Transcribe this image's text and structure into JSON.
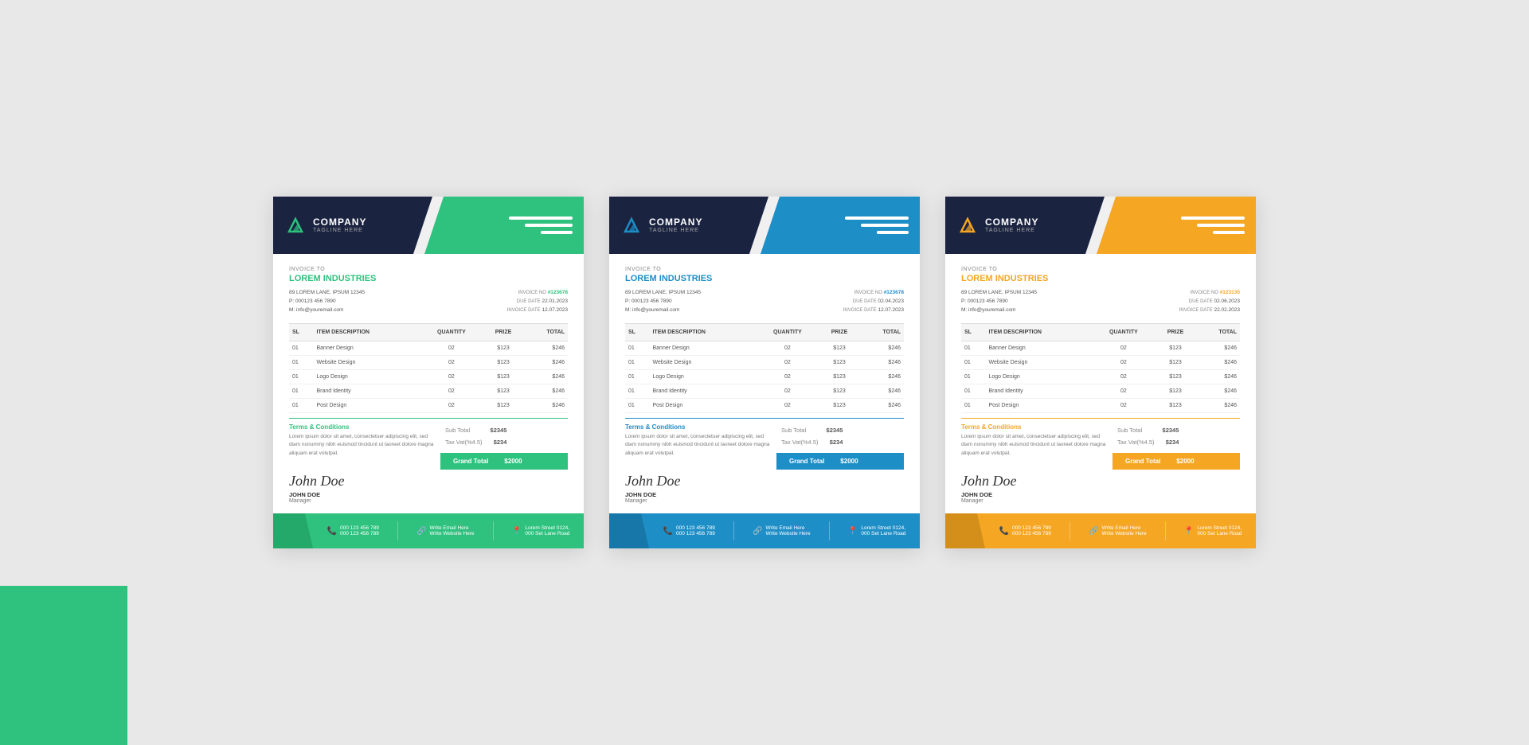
{
  "invoices": [
    {
      "id": "invoice-green",
      "accent": "#2ec27e",
      "accent_dark": "#25a96b",
      "header_bg": "#1a2340",
      "company_name": "COMPANY",
      "tagline": "TAGLINE HERE",
      "invoice_to_label": "INVOICE TO",
      "client_name": "LOREM INDUSTRIES",
      "client_address": "89 LOREM LANE, IPSUM 12345",
      "client_phone": "P: 000123 456 7890",
      "client_mobile": "M: info@youremail.com",
      "invoice_no_label": "INVOICE NO",
      "invoice_no": "#123678",
      "due_date_label": "DUE DATE",
      "due_date": "22.01.2023",
      "inv_date_label": "INVOICE DATE",
      "inv_date": "12.07.2023",
      "table_headers": [
        "SL",
        "ITEM DESCRIPTION",
        "QUANTITY",
        "PRIZE",
        "TOTAL"
      ],
      "table_rows": [
        [
          "01",
          "Banner Design",
          "02",
          "$123",
          "$246"
        ],
        [
          "01",
          "Website Design",
          "02",
          "$123",
          "$246"
        ],
        [
          "01",
          "Logo Design",
          "02",
          "$123",
          "$246"
        ],
        [
          "01",
          "Brand Identity",
          "02",
          "$123",
          "$246"
        ],
        [
          "01",
          "Post Design",
          "02",
          "$123",
          "$246"
        ]
      ],
      "sub_total_label": "Sub Total",
      "sub_total": "$2345",
      "tax_label": "Tax Vat(%4.5)",
      "tax": "$234",
      "grand_total_label": "Grand Total",
      "grand_total": "$2000",
      "terms_title": "Terms & Conditions",
      "terms_text": "Lorem ipsum dolor sit amet, consectetuer adipiscing elit, sed diam nonummy nibh euismod tincidunt ut laoreet dolore magna aliquam erat volutpat.",
      "sig_name": "JOHN DOE",
      "sig_title": "Manager",
      "footer_phone": "000 123 456 789\n000 123 456 789",
      "footer_email": "Write Email Here\nWrite Website Here",
      "footer_address": "Lorem Street 0124,\n000 Set Lane Road"
    },
    {
      "id": "invoice-blue",
      "accent": "#1e8ec7",
      "accent_dark": "#1677a8",
      "header_bg": "#1a2340",
      "company_name": "COMPANY",
      "tagline": "TAGLINE HERE",
      "invoice_to_label": "INVOICE TO",
      "client_name": "LOREM INDUSTRIES",
      "client_address": "89 LOREM LANE, IPSUM 12345",
      "client_phone": "P: 000123 456 7890",
      "client_mobile": "M: info@youremail.com",
      "invoice_no_label": "INVOICE NO",
      "invoice_no": "#123678",
      "due_date_label": "DUE DATE",
      "due_date": "02.04.2023",
      "inv_date_label": "INVOICE DATE",
      "inv_date": "12.07.2023",
      "table_headers": [
        "SL",
        "ITEM DESCRIPTION",
        "QUANTITY",
        "PRIZE",
        "TOTAL"
      ],
      "table_rows": [
        [
          "01",
          "Banner Design",
          "02",
          "$123",
          "$246"
        ],
        [
          "01",
          "Website Design",
          "02",
          "$123",
          "$246"
        ],
        [
          "01",
          "Logo Design",
          "02",
          "$123",
          "$246"
        ],
        [
          "01",
          "Brand Identity",
          "02",
          "$123",
          "$246"
        ],
        [
          "01",
          "Post Design",
          "02",
          "$123",
          "$246"
        ]
      ],
      "sub_total_label": "Sub Total",
      "sub_total": "$2345",
      "tax_label": "Tax Vat(%4.5)",
      "tax": "$234",
      "grand_total_label": "Grand Total",
      "grand_total": "$2000",
      "terms_title": "Terms & Conditions",
      "terms_text": "Lorem ipsum dolor sit amet, consectetuer adipiscing elit, sed diam nonummy nibh euismod tincidunt ut laoreet dolore magna aliquam erat volutpat.",
      "sig_name": "JOHN DOE",
      "sig_title": "Manager",
      "footer_phone": "000 123 456 789\n000 123 456 789",
      "footer_email": "Write Email Here\nWrite Website Here",
      "footer_address": "Lorem Street 0124,\n000 Set Lane Road"
    },
    {
      "id": "invoice-orange",
      "accent": "#f5a623",
      "accent_dark": "#d48f1a",
      "header_bg": "#1a2340",
      "company_name": "COMPANY",
      "tagline": "TAGLINE HERE",
      "invoice_to_label": "INVOICE TO",
      "client_name": "LOREM INDUSTRIES",
      "client_address": "89 LOREM LANE, IPSUM 12345",
      "client_phone": "P: 000123 456 7890",
      "client_mobile": "M: info@youremail.com",
      "invoice_no_label": "INVOICE NO",
      "invoice_no": "#123135",
      "due_date_label": "DUE DATE",
      "due_date": "02.06.2023",
      "inv_date_label": "INVOICE DATE",
      "inv_date": "22.02.2023",
      "table_headers": [
        "SL",
        "ITEM DESCRIPTION",
        "QUANTITY",
        "PRIZE",
        "TOTAL"
      ],
      "table_rows": [
        [
          "01",
          "Banner Design",
          "02",
          "$123",
          "$246"
        ],
        [
          "01",
          "Website Design",
          "02",
          "$123",
          "$246"
        ],
        [
          "01",
          "Logo Design",
          "02",
          "$123",
          "$246"
        ],
        [
          "01",
          "Brand Identity",
          "02",
          "$123",
          "$246"
        ],
        [
          "01",
          "Post Design",
          "02",
          "$123",
          "$246"
        ]
      ],
      "sub_total_label": "Sub Total",
      "sub_total": "$2345",
      "tax_label": "Tax Vat(%4.5)",
      "tax": "$234",
      "grand_total_label": "Grand Total",
      "grand_total": "$2000",
      "terms_title": "Terms & Conditions",
      "terms_text": "Lorem ipsum dolor sit amet, consectetuer adipiscing elit, sed diam nonummy nibh euismod tincidunt ut laoreet dolore magna aliquam erat volutpat.",
      "sig_name": "JOHN DOE",
      "sig_title": "Manager",
      "footer_phone": "000 123 456 789\n000 123 456 789",
      "footer_email": "Write Email Here\nWrite Website Here",
      "footer_address": "Lorem Street 0124,\n000 Set Lane Road"
    }
  ]
}
